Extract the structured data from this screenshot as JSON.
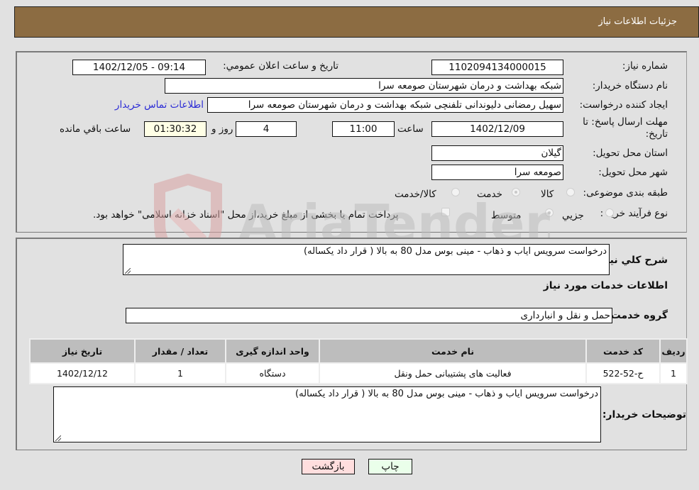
{
  "header": {
    "title": "جزئیات اطلاعات نیاز"
  },
  "details": {
    "need_number_label": "شماره نیاز:",
    "need_number": "1102094134000015",
    "announce_label": "تاریخ و ساعت اعلان عمومي:",
    "announce_value": "1402/12/05 - 09:14",
    "buyer_org_label": "نام دستگاه خریدار:",
    "buyer_org": "شبکه بهداشت و درمان شهرستان صومعه سرا",
    "creator_label": "ایجاد کننده درخواست:",
    "creator": "سهیل رمضانی دلیوندانی تلفنچی شبکه بهداشت و درمان شهرستان صومعه سرا",
    "contact_link": "اطلاعات تماس خریدار",
    "deadline_label": "مهلت ارسال پاسخ: تا تاریخ:",
    "deadline_date": "1402/12/09",
    "time_label": "ساعت",
    "deadline_time": "11:00",
    "days_value": "4",
    "days_label": "روز و",
    "remaining_time": "01:30:32",
    "remaining_label": "ساعت باقي مانده",
    "province_label": "استان محل تحویل:",
    "province": "گیلان",
    "city_label": "شهر محل تحویل:",
    "city": "صومعه سرا",
    "category_label": "طبقه بندی موضوعی:",
    "category_options": [
      {
        "label": "کالا",
        "checked": false
      },
      {
        "label": "خدمت",
        "checked": true
      },
      {
        "label": "کالا/خدمت",
        "checked": false
      }
    ],
    "process_label": "نوع فرآیند خرید :",
    "process_options": [
      {
        "label": "جزيي",
        "checked": false
      },
      {
        "label": "متوسط",
        "checked": true
      }
    ],
    "treasury_note": "پرداخت تمام یا بخشی از مبلغ خرید،از محل \"اسناد خزانه اسلامی\" خواهد بود."
  },
  "services": {
    "summary_label": "شرح كلي نياز:",
    "summary": "درخواست سرویس ایاب و ذهاب - مینی بوس مدل 80 به بالا ( قرار داد یکساله)",
    "section_title": "اطلاعات خدمات مورد نياز",
    "group_label": "گروه خدمت:",
    "group_value": "حمل و نقل و انبارداری",
    "table": {
      "headers": [
        "ردیف",
        "کد خدمت",
        "نام خدمت",
        "واحد اندازه گیری",
        "تعداد / مقدار",
        "تاریخ نیاز"
      ],
      "rows": [
        [
          "1",
          "ح-52-522",
          "فعالیت های پشتیبانی حمل ونقل",
          "دستگاه",
          "1",
          "1402/12/12"
        ]
      ]
    },
    "buyer_notes_label": "توضیحات خریدار:",
    "buyer_notes": "درخواست سرویس ایاب و ذهاب - مینی بوس مدل 80 به بالا ( قرار داد یکساله)"
  },
  "buttons": {
    "print": "چاپ",
    "back": "بازگشت"
  },
  "watermark": {
    "text": "AriaTender.neT"
  },
  "colors": {
    "header_bg": "#8c6c42",
    "print_bg": "#eaffea",
    "back_bg": "#ffdede",
    "link": "#2b2bd6"
  }
}
